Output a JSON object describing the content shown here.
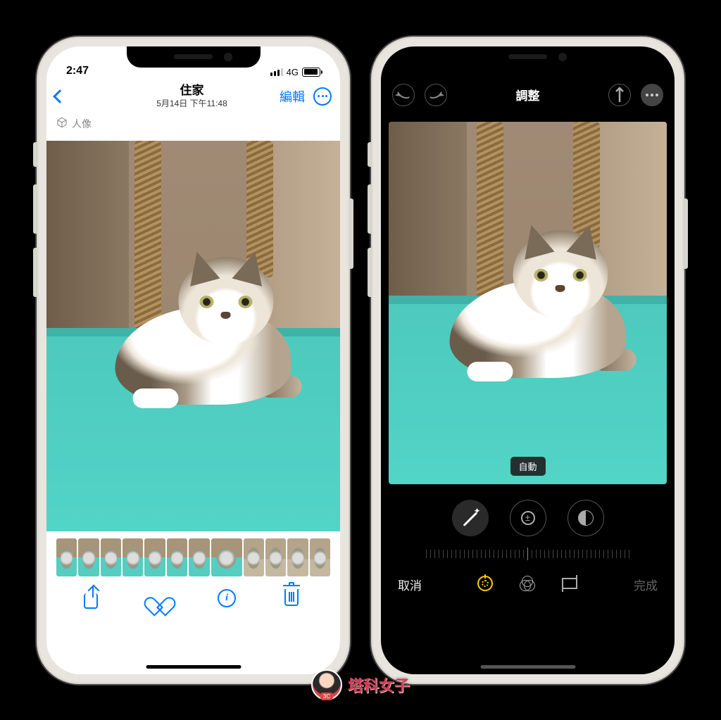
{
  "left_phone": {
    "status": {
      "time": "2:47",
      "carrier": "4G"
    },
    "nav": {
      "title": "住家",
      "subtitle": "5月14日 下午11:48",
      "edit": "編輯"
    },
    "mode_label": "人像"
  },
  "right_phone": {
    "nav": {
      "title": "調整"
    },
    "auto_badge": "自動",
    "bottom": {
      "cancel": "取消",
      "done": "完成"
    }
  },
  "watermark": "塔科女子"
}
